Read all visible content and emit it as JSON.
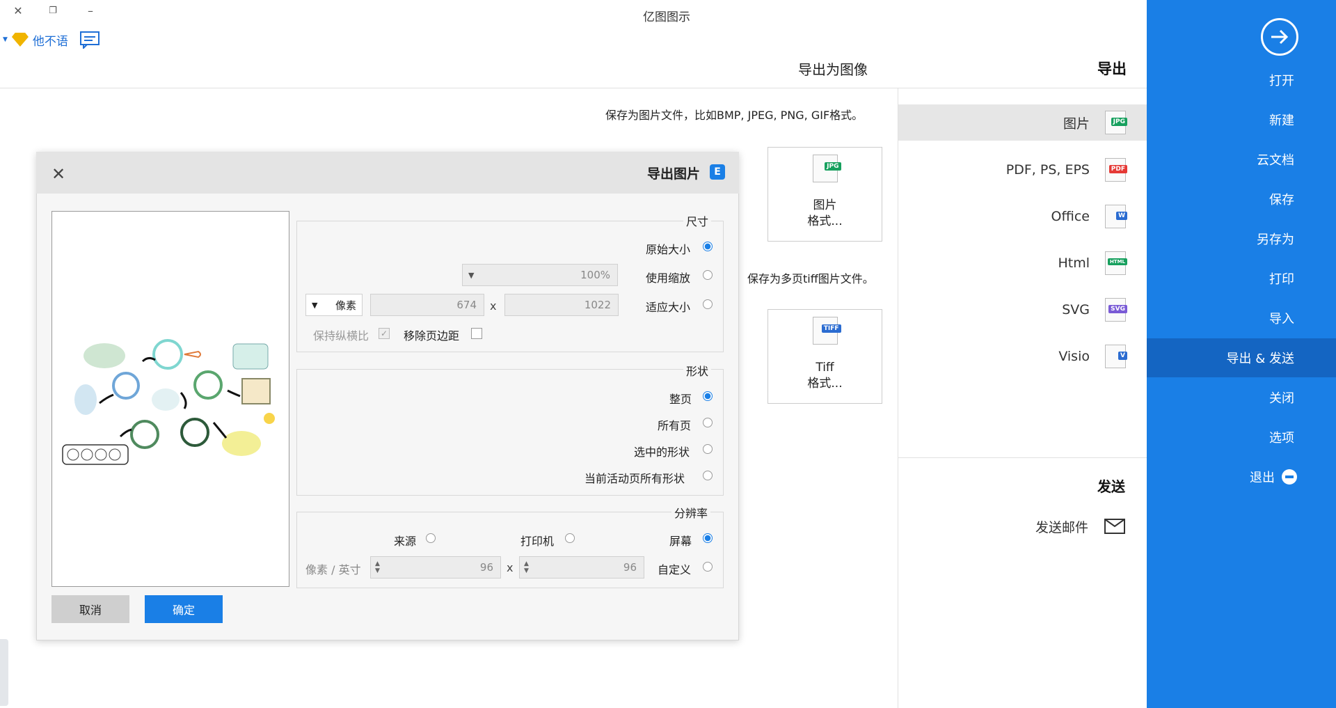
{
  "window": {
    "title": "亿图图示",
    "user": "他不语"
  },
  "header": {
    "page_heading": "导出为图像",
    "section_title": "导出"
  },
  "sidebar": {
    "items": [
      {
        "label": "打开"
      },
      {
        "label": "新建"
      },
      {
        "label": "云文档"
      },
      {
        "label": "保存"
      },
      {
        "label": "另存为"
      },
      {
        "label": "打印"
      },
      {
        "label": "导入"
      },
      {
        "label": "导出 & 发送",
        "active": true
      },
      {
        "label": "关闭"
      },
      {
        "label": "选项"
      },
      {
        "label": "退出"
      }
    ]
  },
  "formats": {
    "items": [
      {
        "label": "图片",
        "tag": "JPG",
        "color": "#17a05e"
      },
      {
        "label": "PDF, PS, EPS",
        "tag": "PDF",
        "color": "#e53935"
      },
      {
        "label": "Office",
        "tag": "W",
        "color": "#2b6cd1"
      },
      {
        "label": "Html",
        "tag": "HTML",
        "color": "#17a05e"
      },
      {
        "label": "SVG",
        "tag": "SVG",
        "color": "#7a5bd6"
      },
      {
        "label": "Visio",
        "tag": "V",
        "color": "#2b6cd1"
      }
    ],
    "send_title": "发送",
    "send_mail": "发送邮件"
  },
  "content": {
    "desc_image": "保存为图片文件，比如BMP, JPEG, PNG, GIF格式。",
    "desc_tiff": "保存为多页tiff图片文件。",
    "card_image": {
      "line1": "图片",
      "line2": "格式...",
      "tag": "JPG"
    },
    "card_tiff": {
      "line1": "Tiff",
      "line2": "格式...",
      "tag": "TIFF"
    }
  },
  "dialog": {
    "title": "导出图片",
    "size": {
      "label": "尺寸",
      "original": "原始大小",
      "scale": "使用缩放",
      "scale_value": "100%",
      "fit": "适应大小",
      "width": "1022",
      "height": "674",
      "x": "x",
      "unit": "像素",
      "remove_margin": "移除页边距",
      "keep_ratio": "保持纵横比"
    },
    "shape": {
      "label": "形状",
      "whole_page": "整页",
      "all_pages": "所有页",
      "selected": "选中的形状",
      "current_page": "当前活动页所有形状"
    },
    "resolution": {
      "label": "分辨率",
      "screen": "屏幕",
      "printer": "打印机",
      "source": "来源",
      "custom": "自定义",
      "dpi_x": "96",
      "dpi_y": "96",
      "x": "x",
      "unit": "像素 / 英寸"
    },
    "ok": "确定",
    "cancel": "取消"
  }
}
